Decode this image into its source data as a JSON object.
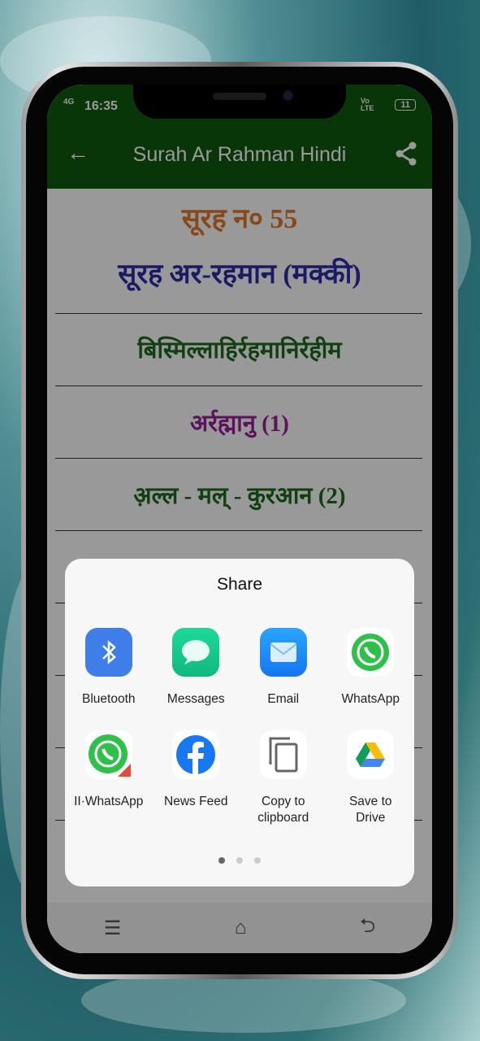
{
  "status": {
    "network": "4G",
    "time": "16:35",
    "volte": "Vo LTE",
    "battery": "11"
  },
  "appbar": {
    "title": "Surah Ar Rahman Hindi",
    "back_icon": "arrow-left-icon",
    "share_icon": "share-icon",
    "color": "#0e5a10"
  },
  "content": {
    "surah_number": "सूरह न० 55",
    "surah_name": "सूरह अर-रहमान (मक्की)",
    "lines": [
      "बिस्मिल्लाहिर्रहमानिर्रहीम",
      "अर्रह्मानु (1)",
      "अ़ल्ल - मल् - कुरआन (2)"
    ]
  },
  "share_sheet": {
    "title": "Share",
    "apps": [
      {
        "label": "Bluetooth",
        "icon": "bluetooth-icon"
      },
      {
        "label": "Messages",
        "icon": "messages-icon"
      },
      {
        "label": "Email",
        "icon": "email-icon"
      },
      {
        "label": "WhatsApp",
        "icon": "whatsapp-icon"
      },
      {
        "label": "II·WhatsApp",
        "icon": "whatsapp-clone-icon"
      },
      {
        "label": "News Feed",
        "icon": "facebook-icon"
      },
      {
        "label": "Copy to clipboard",
        "icon": "copy-icon"
      },
      {
        "label": "Save to Drive",
        "icon": "google-drive-icon"
      }
    ],
    "page": 1,
    "pages": 3
  },
  "navbar": {
    "menu_icon": "menu-icon",
    "home_icon": "home-icon",
    "back_icon": "back-icon"
  }
}
